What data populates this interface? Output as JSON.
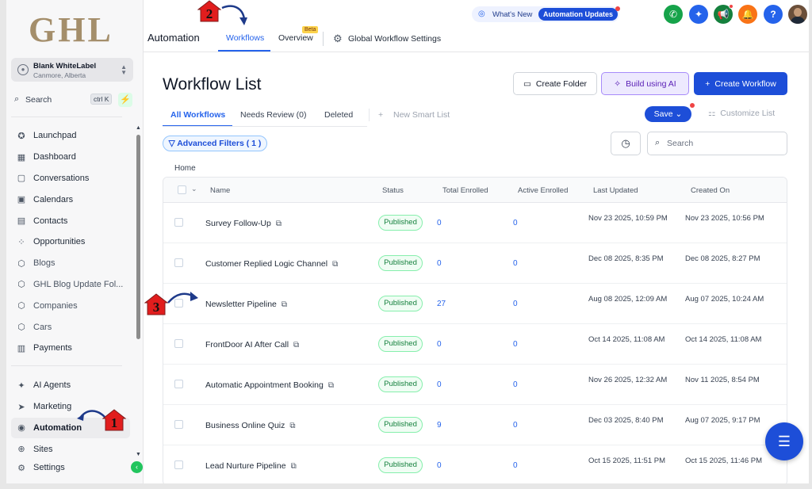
{
  "sidebar": {
    "logo": "GHL",
    "account": {
      "name": "Blank WhiteLabel",
      "location": "Canmore, Alberta"
    },
    "search": {
      "label": "Search",
      "shortcut": "ctrl K"
    },
    "items": [
      {
        "label": "Launchpad",
        "icon": "rocket-icon"
      },
      {
        "label": "Dashboard",
        "icon": "dashboard-icon"
      },
      {
        "label": "Conversations",
        "icon": "chat-icon"
      },
      {
        "label": "Calendars",
        "icon": "calendar-icon"
      },
      {
        "label": "Contacts",
        "icon": "contacts-icon"
      },
      {
        "label": "Opportunities",
        "icon": "opportunities-icon"
      },
      {
        "label": "Blogs",
        "icon": "cube-icon"
      },
      {
        "label": "GHL Blog Update Fol...",
        "icon": "cube-icon"
      },
      {
        "label": "Companies",
        "icon": "cube-icon"
      },
      {
        "label": "Cars",
        "icon": "cube-icon"
      },
      {
        "label": "Payments",
        "icon": "payments-icon"
      }
    ],
    "items2": [
      {
        "label": "AI Agents",
        "icon": "sparkle-icon"
      },
      {
        "label": "Marketing",
        "icon": "send-icon"
      },
      {
        "label": "Automation",
        "icon": "automation-icon"
      },
      {
        "label": "Sites",
        "icon": "globe-icon"
      },
      {
        "label": "Settings",
        "icon": "gear-icon"
      }
    ]
  },
  "topbar": {
    "title": "Automation",
    "tabs": [
      {
        "label": "Workflows"
      },
      {
        "label": "Overview"
      }
    ],
    "beta": "Beta",
    "global_settings": "Global Workflow Settings",
    "whats_new": "What's New",
    "updates_pill": "Automation Updates"
  },
  "main": {
    "title": "Workflow List",
    "buttons": {
      "create_folder": "Create Folder",
      "build_ai": "Build using AI",
      "create_workflow": "Create Workflow"
    },
    "tabs": [
      "All Workflows",
      "Needs Review (0)",
      "Deleted"
    ],
    "new_smart_list": "New Smart List",
    "save": "Save",
    "customize": "Customize List",
    "advanced_filters": "Advanced Filters ( 1 )",
    "search_placeholder": "Search",
    "breadcrumb": "Home",
    "columns": [
      "Name",
      "Status",
      "Total Enrolled",
      "Active Enrolled",
      "Last Updated",
      "Created On"
    ],
    "rows": [
      {
        "name": "Survey Follow-Up",
        "status": "Published",
        "total": "0",
        "active": "0",
        "updated": "Nov 23 2025, 10:59 PM",
        "created": "Nov 23 2025, 10:56 PM"
      },
      {
        "name": "Customer Replied Logic Channel",
        "status": "Published",
        "total": "0",
        "active": "0",
        "updated": "Dec 08 2025, 8:35 PM",
        "created": "Dec 08 2025, 8:27 PM"
      },
      {
        "name": "Newsletter Pipeline",
        "status": "Published",
        "total": "27",
        "active": "0",
        "updated": "Aug 08 2025, 12:09 AM",
        "created": "Aug 07 2025, 10:24 AM"
      },
      {
        "name": "FrontDoor AI After Call",
        "status": "Published",
        "total": "0",
        "active": "0",
        "updated": "Oct 14 2025, 11:08 AM",
        "created": "Oct 14 2025, 11:08 AM"
      },
      {
        "name": "Automatic Appointment Booking",
        "status": "Published",
        "total": "0",
        "active": "0",
        "updated": "Nov 26 2025, 12:32 AM",
        "created": "Nov 11 2025, 8:54 PM"
      },
      {
        "name": "Business Online Quiz",
        "status": "Published",
        "total": "9",
        "active": "0",
        "updated": "Dec 03 2025, 8:40 PM",
        "created": "Aug 07 2025, 9:17 PM"
      },
      {
        "name": "Lead Nurture Pipeline",
        "status": "Published",
        "total": "0",
        "active": "0",
        "updated": "Oct 15 2025, 11:51 PM",
        "created": "Oct 15 2025, 11:46 PM"
      }
    ]
  },
  "annotations": [
    "1",
    "2",
    "3"
  ],
  "colors": {
    "accent": "#1d4ed8",
    "published_green": "#15803d",
    "logo_gold": "#a48e6b",
    "annotation_red": "#e11d1d"
  }
}
